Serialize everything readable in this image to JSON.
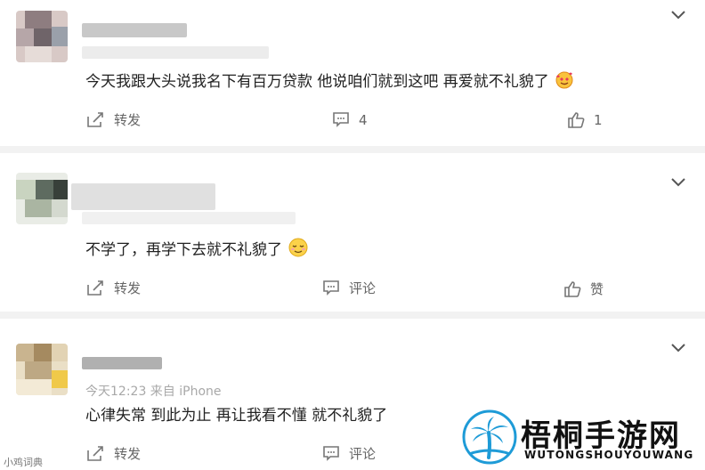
{
  "comments": [
    {
      "text": "今天我跟大头说我名下有百万贷款 他说咱们就到这吧 再爱就不礼貌了",
      "emoji": "smiling-face-with-hearts",
      "repost_label": "转发",
      "comment_label": "4",
      "like_label": "1"
    },
    {
      "text": "不学了，再学下去就不礼貌了",
      "emoji": "relieved-face",
      "repost_label": "转发",
      "comment_label": "评论",
      "like_label": "赞"
    },
    {
      "time_source": "今天12:23 来自 iPhone",
      "text": "心律失常 到此为止 再让我看不懂 就不礼貌了",
      "repost_label": "转发",
      "comment_label": "评论"
    }
  ],
  "watermark_left": "小鸡词典",
  "logo": {
    "title": "梧桐手游网",
    "subtitle": "WUTONGSHOUYOUWANG",
    "color": "#1e9bd7"
  }
}
